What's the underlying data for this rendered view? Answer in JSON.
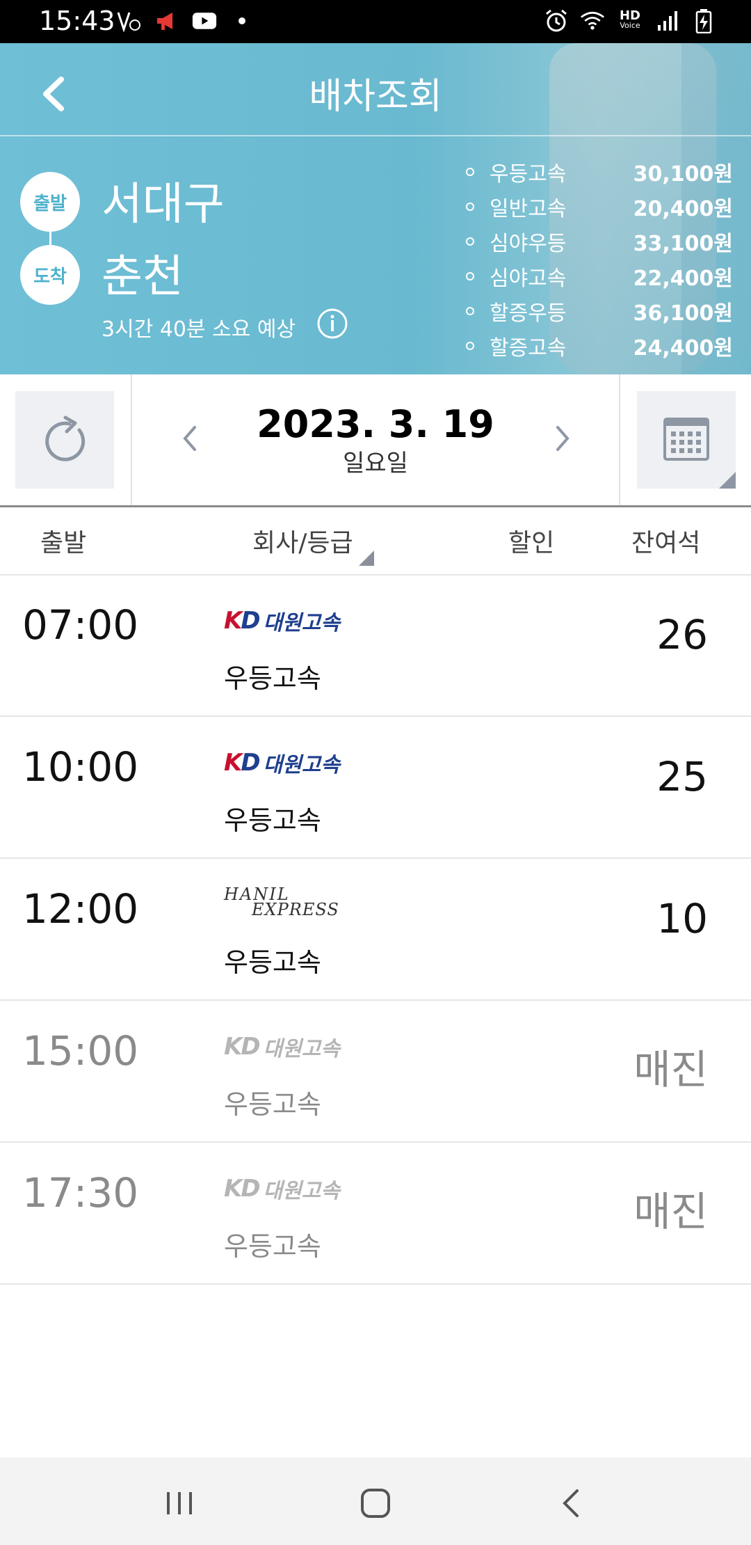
{
  "status_bar": {
    "time": "15:43",
    "left_icons": [
      "volte-icon",
      "megaphone-icon",
      "youtube-icon",
      "dot-icon"
    ],
    "right_icons": [
      "alarm-icon",
      "wifi-icon",
      "hd-voice-icon",
      "signal-icon",
      "battery-charging-icon"
    ],
    "hd_label": "HD",
    "voice_label": "Voice"
  },
  "header": {
    "title": "배차조회",
    "depart_badge": "출발",
    "arrive_badge": "도착",
    "depart_city": "서대구",
    "arrive_city": "춘천",
    "duration": "3시간 40분 소요 예상",
    "fares": [
      {
        "name": "우등고속",
        "price": "30,100원"
      },
      {
        "name": "일반고속",
        "price": "20,400원"
      },
      {
        "name": "심야우등",
        "price": "33,100원"
      },
      {
        "name": "심야고속",
        "price": "22,400원"
      },
      {
        "name": "할증우등",
        "price": "36,100원"
      },
      {
        "name": "할증고속",
        "price": "24,400원"
      }
    ]
  },
  "date_bar": {
    "date": "2023. 3. 19",
    "weekday": "일요일"
  },
  "table": {
    "headers": {
      "depart": "출발",
      "company": "회사/등급",
      "discount": "할인",
      "seats": "잔여석"
    },
    "rows": [
      {
        "time": "07:00",
        "company": "대원고속",
        "grade": "우등고속",
        "seats": "26"
      },
      {
        "time": "10:00",
        "company": "대원고속",
        "grade": "우등고속",
        "seats": "25"
      },
      {
        "time": "12:00",
        "company_line1": "HANIL",
        "company_line2": "EXPRESS",
        "grade": "우등고속",
        "seats": "10"
      },
      {
        "time": "15:00",
        "company": "대원고속",
        "grade": "우등고속",
        "seats": "매진"
      },
      {
        "time": "17:30",
        "company": "대원고속",
        "grade": "우등고속",
        "seats": "매진"
      }
    ]
  },
  "colors": {
    "header_bg": "#6fbfd6",
    "badge_text": "#4fb2cc",
    "kd_red": "#c8102e",
    "kd_blue": "#1f3f8f",
    "soldout_gray": "#8a8a8a"
  }
}
